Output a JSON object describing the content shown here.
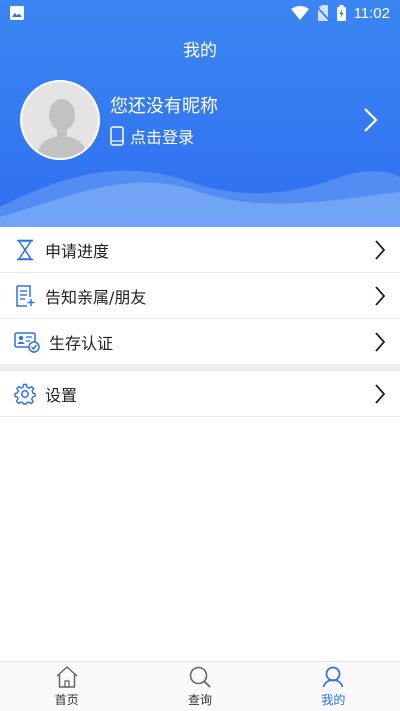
{
  "status_bar": {
    "time": "11:02"
  },
  "header": {
    "title": "我的",
    "nickname": "您还没有昵称",
    "login_label": "点击登录"
  },
  "menu": {
    "items": [
      {
        "label": "申请进度",
        "icon": "hourglass-icon"
      },
      {
        "label": "告知亲属/朋友",
        "icon": "document-add-icon"
      },
      {
        "label": "生存认证",
        "icon": "id-card-check-icon"
      },
      {
        "label": "设置",
        "icon": "gear-icon"
      }
    ]
  },
  "tabbar": {
    "tabs": [
      {
        "label": "首页",
        "icon": "home-icon"
      },
      {
        "label": "查询",
        "icon": "search-icon"
      },
      {
        "label": "我的",
        "icon": "user-icon",
        "active": true
      }
    ]
  },
  "colors": {
    "accent": "#2f6ff0",
    "header_top": "#3b86f2"
  }
}
